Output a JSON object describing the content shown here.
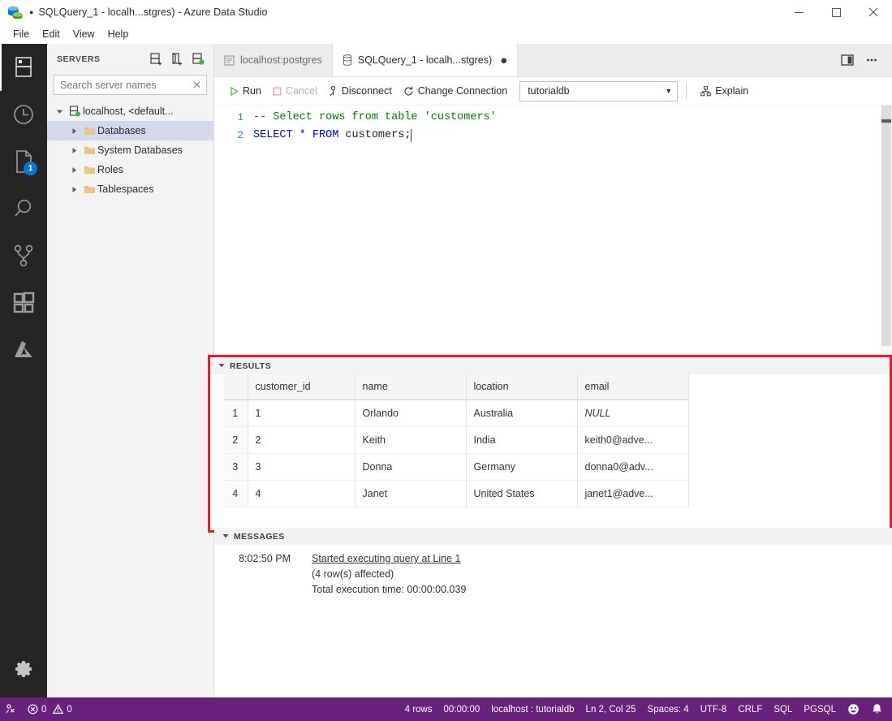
{
  "window": {
    "title": "SQLQuery_1 - localh...stgres) - Azure Data Studio",
    "dirty_dot": "●",
    "minimize_label": "─",
    "maximize_label": "☐",
    "close_label": "✕"
  },
  "menubar": {
    "items": [
      {
        "label": "File"
      },
      {
        "label": "Edit"
      },
      {
        "label": "View"
      },
      {
        "label": "Help"
      }
    ]
  },
  "activitybar": {
    "items": [
      {
        "name": "servers",
        "icon": "servers-icon",
        "active": true,
        "badge": ""
      },
      {
        "name": "query-history",
        "icon": "clock-icon",
        "active": false,
        "badge": ""
      },
      {
        "name": "notebooks",
        "icon": "notebook-icon",
        "active": false,
        "badge": "1"
      },
      {
        "name": "search",
        "icon": "search-icon",
        "active": false,
        "badge": ""
      },
      {
        "name": "source-control",
        "icon": "source-control-icon",
        "active": false,
        "badge": ""
      },
      {
        "name": "extensions",
        "icon": "extensions-icon",
        "active": false,
        "badge": ""
      },
      {
        "name": "azure",
        "icon": "azure-icon",
        "active": false,
        "badge": ""
      }
    ],
    "settings": {
      "name": "manage",
      "icon": "gear-icon"
    }
  },
  "sidebar": {
    "title": "SERVERS",
    "actions": [
      {
        "name": "new-connection",
        "icon": "add-server-icon"
      },
      {
        "name": "new-server-group",
        "icon": "add-server-group-icon"
      },
      {
        "name": "show-active-connections",
        "icon": "active-connections-icon"
      }
    ],
    "search": {
      "placeholder": "Search server names",
      "value": "",
      "clear": "✕"
    },
    "tree": [
      {
        "label": "localhost, <default...",
        "level": 0,
        "expanded": true,
        "icon": "server-icon",
        "selected": false
      },
      {
        "label": "Databases",
        "level": 1,
        "expanded": false,
        "icon": "folder-icon",
        "selected": true
      },
      {
        "label": "System Databases",
        "level": 1,
        "expanded": false,
        "icon": "folder-icon",
        "selected": false
      },
      {
        "label": "Roles",
        "level": 1,
        "expanded": false,
        "icon": "folder-icon",
        "selected": false
      },
      {
        "label": "Tablespaces",
        "level": 1,
        "expanded": false,
        "icon": "folder-icon",
        "selected": false
      }
    ]
  },
  "tabs": {
    "items": [
      {
        "label": "localhost:postgres",
        "icon": "dashboard-icon",
        "active": false,
        "dirty": false
      },
      {
        "label": "SQLQuery_1 - localh...stgres)",
        "icon": "database-icon",
        "active": true,
        "dirty": true
      }
    ],
    "dirty_glyph": "●",
    "actions": [
      {
        "name": "split-editor",
        "icon": "split-editor-icon"
      },
      {
        "name": "more-actions",
        "icon": "ellipsis-icon"
      }
    ]
  },
  "query_toolbar": {
    "run": {
      "label": "Run",
      "icon": "play-icon",
      "disabled": false
    },
    "cancel": {
      "label": "Cancel",
      "icon": "stop-icon",
      "disabled": true
    },
    "disconnect": {
      "label": "Disconnect",
      "icon": "disconnect-icon",
      "disabled": false
    },
    "change_connection": {
      "label": "Change Connection",
      "icon": "change-connection-icon",
      "disabled": false
    },
    "database_select": {
      "value": "tutorialdb",
      "caret": "▼"
    },
    "explain": {
      "label": "Explain",
      "icon": "explain-icon",
      "disabled": false
    }
  },
  "editor": {
    "lines": [
      {
        "number": "1",
        "comment": "-- Select rows from table 'customers'"
      },
      {
        "number": "2",
        "kw1": "SELECT",
        "star": " * ",
        "kw2": "FROM",
        "rest": " customers;"
      }
    ]
  },
  "results": {
    "panel_title": "RESULTS",
    "chevron": "▼",
    "columns": [
      "",
      "customer_id",
      "name",
      "location",
      "email"
    ],
    "rows": [
      {
        "n": "1",
        "customer_id": "1",
        "name": "Orlando",
        "location": "Australia",
        "email": "NULL",
        "email_is_null": true
      },
      {
        "n": "2",
        "customer_id": "2",
        "name": "Keith",
        "location": "India",
        "email": "keith0@adve...",
        "email_is_null": false
      },
      {
        "n": "3",
        "customer_id": "3",
        "name": "Donna",
        "location": "Germany",
        "email": "donna0@adv...",
        "email_is_null": false
      },
      {
        "n": "4",
        "customer_id": "4",
        "name": "Janet",
        "location": "United States",
        "email": "janet1@adve...",
        "email_is_null": false
      }
    ],
    "actions": [
      {
        "name": "save-as-excel",
        "icon": "save-excel-icon"
      },
      {
        "name": "save-as-csv",
        "icon": "save-csv-icon"
      },
      {
        "name": "save-as-json",
        "icon": "save-json-icon"
      },
      {
        "name": "save-as-xml",
        "icon": "save-xml-icon"
      },
      {
        "name": "show-chart",
        "icon": "chart-icon"
      }
    ],
    "highlight_color": "#ee1c25"
  },
  "messages": {
    "panel_title": "MESSAGES",
    "chevron": "▼",
    "entries": [
      {
        "time": "8:02:50 PM",
        "text": "Started executing query at Line 1",
        "link": true
      },
      {
        "time": "",
        "text": "(4 row(s) affected)",
        "link": false
      },
      {
        "time": "",
        "text": "Total execution time: 00:00:00.039",
        "link": false
      }
    ]
  },
  "statusbar": {
    "left": [
      {
        "name": "remote",
        "icon": "remote-icon",
        "label": ""
      },
      {
        "name": "problems",
        "icon": "error-warning-icon",
        "errors": "0",
        "warnings": "0"
      }
    ],
    "right": [
      {
        "name": "row-count",
        "label": "4 rows"
      },
      {
        "name": "execution-time",
        "label": "00:00:00"
      },
      {
        "name": "connection",
        "label": "localhost : tutorialdb"
      },
      {
        "name": "cursor-position",
        "label": "Ln 2, Col 25"
      },
      {
        "name": "indentation",
        "label": "Spaces: 4"
      },
      {
        "name": "encoding",
        "label": "UTF-8"
      },
      {
        "name": "eol",
        "label": "CRLF"
      },
      {
        "name": "language-mode",
        "label": "SQL"
      },
      {
        "name": "provider",
        "label": "PGSQL"
      },
      {
        "name": "feedback",
        "label": "☺"
      },
      {
        "name": "notifications",
        "label": "🔔"
      }
    ],
    "background": "#68217a"
  }
}
